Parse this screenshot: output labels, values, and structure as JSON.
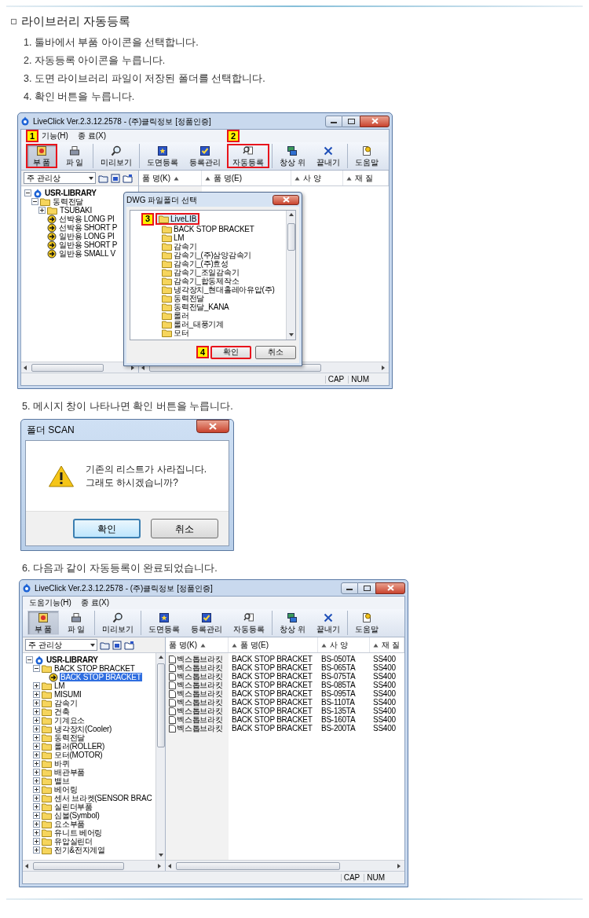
{
  "heading": "라이브러리 자동등록",
  "steps": [
    "1. 툴바에서 부품 아이콘을 선택합니다.",
    "2. 자동등록 아이콘을 누릅니다.",
    "3. 도면 라이브러리 파일이 저장된 폴더를 선택합니다.",
    "4. 확인 버튼을 누릅니다."
  ],
  "window_1": {
    "title": "LiveClick Ver.2.3.12.2578 - (주)클릭정보 [정품인증]",
    "menu": [
      "기능(H)",
      "종 료(X)"
    ],
    "toolbar": [
      [
        {
          "label": "부 품",
          "selected": true,
          "callout": "1"
        },
        {
          "label": "파 일",
          "selected": false
        }
      ],
      [
        {
          "label": "미리보기",
          "selected": false
        }
      ],
      [
        {
          "label": "도면등록",
          "selected": false
        },
        {
          "label": "등록관리",
          "selected": false
        },
        {
          "label": "자동등록",
          "selected": false,
          "callout": "2"
        }
      ],
      [
        {
          "label": "창상 위",
          "selected": false
        },
        {
          "label": "끝내기",
          "selected": false
        }
      ],
      [
        {
          "label": "도움말",
          "selected": false
        }
      ]
    ],
    "combo": "주 관리상",
    "columns": [
      "품 명(K)",
      "품 명(E)",
      "사 양",
      "재 질"
    ],
    "tree": [
      {
        "label": "USR-LIBRARY",
        "kind": "root",
        "expanded": true,
        "selected": false,
        "children": [
          {
            "label": "동력전달",
            "kind": "folder",
            "expanded": true,
            "selected": false,
            "children": [
              {
                "label": "TSUBAKI",
                "kind": "folder",
                "expanded": false,
                "selected": false
              },
              {
                "label": "선박용 LONG PI",
                "kind": "part",
                "selected": false
              },
              {
                "label": "선박용 SHORT P",
                "kind": "part",
                "selected": false
              },
              {
                "label": "일반용 LONG PI",
                "kind": "part",
                "selected": false
              },
              {
                "label": "일반용 SHORT P",
                "kind": "part",
                "selected": false
              },
              {
                "label": "일반용 SMALL V",
                "kind": "part",
                "selected": false
              }
            ]
          }
        ]
      }
    ],
    "dialog": {
      "title": "DWG 파일폴더 선택",
      "root": {
        "label": "LiveLIB",
        "selected": true,
        "callout": "3"
      },
      "folders": [
        {
          "label": "BACK STOP BRACKET",
          "selected": false
        },
        {
          "label": "LM",
          "selected": false
        },
        {
          "label": "감속기",
          "selected": false
        },
        {
          "label": "감속기_(주)삼양감속기",
          "selected": false
        },
        {
          "label": "감속기_(주)효성",
          "selected": false
        },
        {
          "label": "감속기_조일감속기",
          "selected": false
        },
        {
          "label": "감속기_합동제작소",
          "selected": false
        },
        {
          "label": "냉각장치_현대홀레아유압(주)",
          "selected": false
        },
        {
          "label": "동력전달",
          "selected": false
        },
        {
          "label": "동력전달_KANA",
          "selected": false
        },
        {
          "label": "롤러",
          "selected": false
        },
        {
          "label": "롤러_태풍기계",
          "selected": false
        },
        {
          "label": "모터",
          "selected": false
        }
      ],
      "buttons": [
        {
          "label": "확인",
          "callout": "4"
        },
        {
          "label": "취소"
        }
      ]
    },
    "status": [
      "CAP",
      "NUM"
    ]
  },
  "step_5": "5. 메시지 창이 나타나면 확인 버튼을 누릅니다.",
  "message_box": {
    "title": "폴더 SCAN",
    "message": [
      "기존의 리스트가 사라집니다.",
      "그래도 하시겠습니까?"
    ],
    "buttons": [
      {
        "label": "확인",
        "default": true
      },
      {
        "label": "취소",
        "default": false
      }
    ]
  },
  "step_6": "6. 다음과 같이 자동등록이 완료되었습니다.",
  "window_2": {
    "title": "LiveClick Ver.2.3.12.2578 - (주)클릭정보 [정품인증]",
    "menu": [
      "도움기능(H)",
      "종 료(X)"
    ],
    "toolbar": [
      [
        {
          "label": "부 품",
          "selected": true
        },
        {
          "label": "파 일",
          "selected": false
        }
      ],
      [
        {
          "label": "미리보기",
          "selected": false
        }
      ],
      [
        {
          "label": "도면등록",
          "selected": false
        },
        {
          "label": "등록관리",
          "selected": false
        },
        {
          "label": "자동등록",
          "selected": false
        }
      ],
      [
        {
          "label": "창상 위",
          "selected": false
        },
        {
          "label": "끝내기",
          "selected": false
        }
      ],
      [
        {
          "label": "도움말",
          "selected": false
        }
      ]
    ],
    "combo": "주 관리상",
    "columns": [
      "품 명(K)",
      "품 명(E)",
      "사 양",
      "재 질"
    ],
    "tree": [
      {
        "label": "USR-LIBRARY",
        "kind": "root",
        "expanded": true,
        "selected": false,
        "children": [
          {
            "label": "BACK STOP BRACKET",
            "kind": "folder",
            "expanded": true,
            "selected": false,
            "children": [
              {
                "label": "BACK STOP BRACKET",
                "kind": "part",
                "selected": true
              }
            ]
          },
          {
            "label": "LM",
            "kind": "folder",
            "expanded": false,
            "selected": false
          },
          {
            "label": "MISUMI",
            "kind": "folder",
            "expanded": false,
            "selected": false
          },
          {
            "label": "감속기",
            "kind": "folder",
            "expanded": false,
            "selected": false
          },
          {
            "label": "건축",
            "kind": "folder",
            "expanded": false,
            "selected": false
          },
          {
            "label": "기계요소",
            "kind": "folder",
            "expanded": false,
            "selected": false
          },
          {
            "label": "냉각장치(Cooler)",
            "kind": "folder",
            "expanded": false,
            "selected": false
          },
          {
            "label": "동력전달",
            "kind": "folder",
            "expanded": false,
            "selected": false
          },
          {
            "label": "롤러(ROLLER)",
            "kind": "folder",
            "expanded": false,
            "selected": false
          },
          {
            "label": "모터(MOTOR)",
            "kind": "folder",
            "expanded": false,
            "selected": false
          },
          {
            "label": "바퀴",
            "kind": "folder",
            "expanded": false,
            "selected": false
          },
          {
            "label": "배관부품",
            "kind": "folder",
            "expanded": false,
            "selected": false
          },
          {
            "label": "밸브",
            "kind": "folder",
            "expanded": false,
            "selected": false
          },
          {
            "label": "베어링",
            "kind": "folder",
            "expanded": false,
            "selected": false
          },
          {
            "label": "센서 브라켓(SENSOR BRAC",
            "kind": "folder",
            "expanded": false,
            "selected": false
          },
          {
            "label": "실린더부품",
            "kind": "folder",
            "expanded": false,
            "selected": false
          },
          {
            "label": "심볼(Symbol)",
            "kind": "folder",
            "expanded": false,
            "selected": false
          },
          {
            "label": "요소부품",
            "kind": "folder",
            "expanded": false,
            "selected": false
          },
          {
            "label": "유니트 베어링",
            "kind": "folder",
            "expanded": false,
            "selected": false
          },
          {
            "label": "유압실린더",
            "kind": "folder",
            "expanded": false,
            "selected": false
          },
          {
            "label": "전기&전자계열",
            "kind": "folder",
            "expanded": false,
            "selected": false
          }
        ]
      }
    ],
    "rows": [
      [
        "벡스톱브라킷",
        "BACK STOP BRACKET",
        "BS-050TA",
        "SS400"
      ],
      [
        "벡스톱브라킷",
        "BACK STOP BRACKET",
        "BS-065TA",
        "SS400"
      ],
      [
        "벡스톱브라킷",
        "BACK STOP BRACKET",
        "BS-075TA",
        "SS400"
      ],
      [
        "벡스톱브라킷",
        "BACK STOP BRACKET",
        "BS-085TA",
        "SS400"
      ],
      [
        "벡스톱브라킷",
        "BACK STOP BRACKET",
        "BS-095TA",
        "SS400"
      ],
      [
        "벡스톱브라킷",
        "BACK STOP BRACKET",
        "BS-110TA",
        "SS400"
      ],
      [
        "벡스톱브라킷",
        "BACK STOP BRACKET",
        "BS-135TA",
        "SS400"
      ],
      [
        "벡스톱브라킷",
        "BACK STOP BRACKET",
        "BS-160TA",
        "SS400"
      ],
      [
        "벡스톱브라킷",
        "BACK STOP BRACKET",
        "BS-200TA",
        "SS400"
      ]
    ],
    "status": [
      "CAP",
      "NUM"
    ]
  }
}
